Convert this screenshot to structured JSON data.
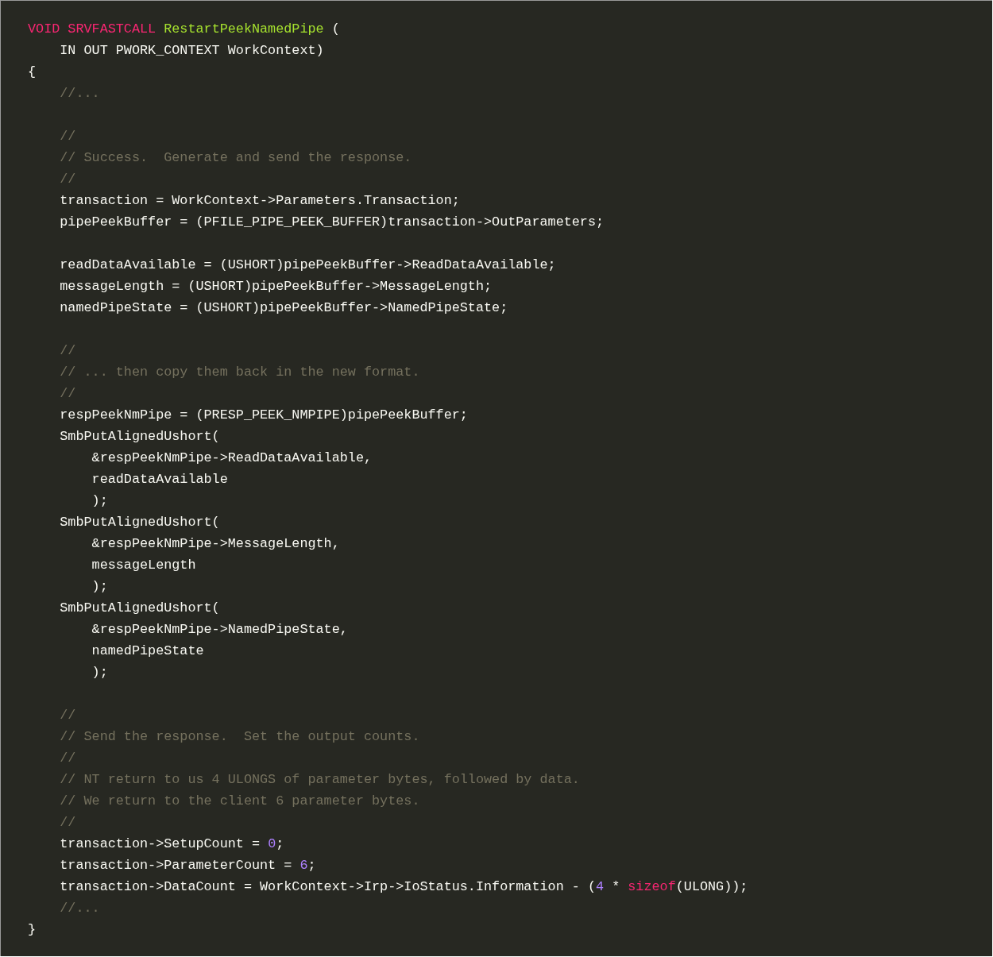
{
  "code_block": {
    "lines": [
      {
        "kind": "code",
        "tokens": [
          {
            "kind": "keyword",
            "text": "VOID SRVFASTCALL "
          },
          {
            "kind": "function",
            "text": "RestartPeekNamedPipe"
          },
          {
            "kind": "plain",
            "text": " ("
          }
        ]
      },
      {
        "kind": "code",
        "tokens": [
          {
            "kind": "plain",
            "text": "    IN OUT PWORK_CONTEXT WorkContext)"
          }
        ]
      },
      {
        "kind": "code",
        "tokens": [
          {
            "kind": "plain",
            "text": "{"
          }
        ]
      },
      {
        "kind": "code",
        "tokens": [
          {
            "kind": "comment",
            "text": "    //..."
          }
        ]
      },
      {
        "kind": "blank"
      },
      {
        "kind": "code",
        "tokens": [
          {
            "kind": "comment",
            "text": "    //"
          }
        ]
      },
      {
        "kind": "code",
        "tokens": [
          {
            "kind": "comment",
            "text": "    // Success.  Generate and send the response."
          }
        ]
      },
      {
        "kind": "code",
        "tokens": [
          {
            "kind": "comment",
            "text": "    //"
          }
        ]
      },
      {
        "kind": "code",
        "tokens": [
          {
            "kind": "plain",
            "text": "    transaction = WorkContext->Parameters.Transaction;"
          }
        ]
      },
      {
        "kind": "code",
        "tokens": [
          {
            "kind": "plain",
            "text": "    pipePeekBuffer = (PFILE_PIPE_PEEK_BUFFER)transaction->OutParameters;"
          }
        ]
      },
      {
        "kind": "blank"
      },
      {
        "kind": "code",
        "tokens": [
          {
            "kind": "plain",
            "text": "    readDataAvailable = (USHORT)pipePeekBuffer->ReadDataAvailable;"
          }
        ]
      },
      {
        "kind": "code",
        "tokens": [
          {
            "kind": "plain",
            "text": "    messageLength = (USHORT)pipePeekBuffer->MessageLength;"
          }
        ]
      },
      {
        "kind": "code",
        "tokens": [
          {
            "kind": "plain",
            "text": "    namedPipeState = (USHORT)pipePeekBuffer->NamedPipeState;"
          }
        ]
      },
      {
        "kind": "blank"
      },
      {
        "kind": "code",
        "tokens": [
          {
            "kind": "comment",
            "text": "    //"
          }
        ]
      },
      {
        "kind": "code",
        "tokens": [
          {
            "kind": "comment",
            "text": "    // ... then copy them back in the new format."
          }
        ]
      },
      {
        "kind": "code",
        "tokens": [
          {
            "kind": "comment",
            "text": "    //"
          }
        ]
      },
      {
        "kind": "code",
        "tokens": [
          {
            "kind": "plain",
            "text": "    respPeekNmPipe = (PRESP_PEEK_NMPIPE)pipePeekBuffer;"
          }
        ]
      },
      {
        "kind": "code",
        "tokens": [
          {
            "kind": "plain",
            "text": "    SmbPutAlignedUshort("
          }
        ]
      },
      {
        "kind": "code",
        "tokens": [
          {
            "kind": "plain",
            "text": "        &respPeekNmPipe->ReadDataAvailable,"
          }
        ]
      },
      {
        "kind": "code",
        "tokens": [
          {
            "kind": "plain",
            "text": "        readDataAvailable"
          }
        ]
      },
      {
        "kind": "code",
        "tokens": [
          {
            "kind": "plain",
            "text": "        );"
          }
        ]
      },
      {
        "kind": "code",
        "tokens": [
          {
            "kind": "plain",
            "text": "    SmbPutAlignedUshort("
          }
        ]
      },
      {
        "kind": "code",
        "tokens": [
          {
            "kind": "plain",
            "text": "        &respPeekNmPipe->MessageLength,"
          }
        ]
      },
      {
        "kind": "code",
        "tokens": [
          {
            "kind": "plain",
            "text": "        messageLength"
          }
        ]
      },
      {
        "kind": "code",
        "tokens": [
          {
            "kind": "plain",
            "text": "        );"
          }
        ]
      },
      {
        "kind": "code",
        "tokens": [
          {
            "kind": "plain",
            "text": "    SmbPutAlignedUshort("
          }
        ]
      },
      {
        "kind": "code",
        "tokens": [
          {
            "kind": "plain",
            "text": "        &respPeekNmPipe->NamedPipeState,"
          }
        ]
      },
      {
        "kind": "code",
        "tokens": [
          {
            "kind": "plain",
            "text": "        namedPipeState"
          }
        ]
      },
      {
        "kind": "code",
        "tokens": [
          {
            "kind": "plain",
            "text": "        );"
          }
        ]
      },
      {
        "kind": "blank"
      },
      {
        "kind": "code",
        "tokens": [
          {
            "kind": "comment",
            "text": "    //"
          }
        ]
      },
      {
        "kind": "code",
        "tokens": [
          {
            "kind": "comment",
            "text": "    // Send the response.  Set the output counts."
          }
        ]
      },
      {
        "kind": "code",
        "tokens": [
          {
            "kind": "comment",
            "text": "    //"
          }
        ]
      },
      {
        "kind": "code",
        "tokens": [
          {
            "kind": "comment",
            "text": "    // NT return to us 4 ULONGS of parameter bytes, followed by data."
          }
        ]
      },
      {
        "kind": "code",
        "tokens": [
          {
            "kind": "comment",
            "text": "    // We return to the client 6 parameter bytes."
          }
        ]
      },
      {
        "kind": "code",
        "tokens": [
          {
            "kind": "comment",
            "text": "    //"
          }
        ]
      },
      {
        "kind": "code",
        "tokens": [
          {
            "kind": "plain",
            "text": "    transaction->SetupCount = "
          },
          {
            "kind": "number",
            "text": "0"
          },
          {
            "kind": "plain",
            "text": ";"
          }
        ]
      },
      {
        "kind": "code",
        "tokens": [
          {
            "kind": "plain",
            "text": "    transaction->ParameterCount = "
          },
          {
            "kind": "number",
            "text": "6"
          },
          {
            "kind": "plain",
            "text": ";"
          }
        ]
      },
      {
        "kind": "code",
        "tokens": [
          {
            "kind": "plain",
            "text": "    transaction->DataCount = WorkContext->Irp->IoStatus.Information - ("
          },
          {
            "kind": "number",
            "text": "4"
          },
          {
            "kind": "plain",
            "text": " * "
          },
          {
            "kind": "keyword",
            "text": "sizeof"
          },
          {
            "kind": "plain",
            "text": "(ULONG));"
          }
        ]
      },
      {
        "kind": "code",
        "tokens": [
          {
            "kind": "comment",
            "text": "    //..."
          }
        ]
      },
      {
        "kind": "code",
        "tokens": [
          {
            "kind": "plain",
            "text": "}"
          }
        ]
      }
    ]
  }
}
